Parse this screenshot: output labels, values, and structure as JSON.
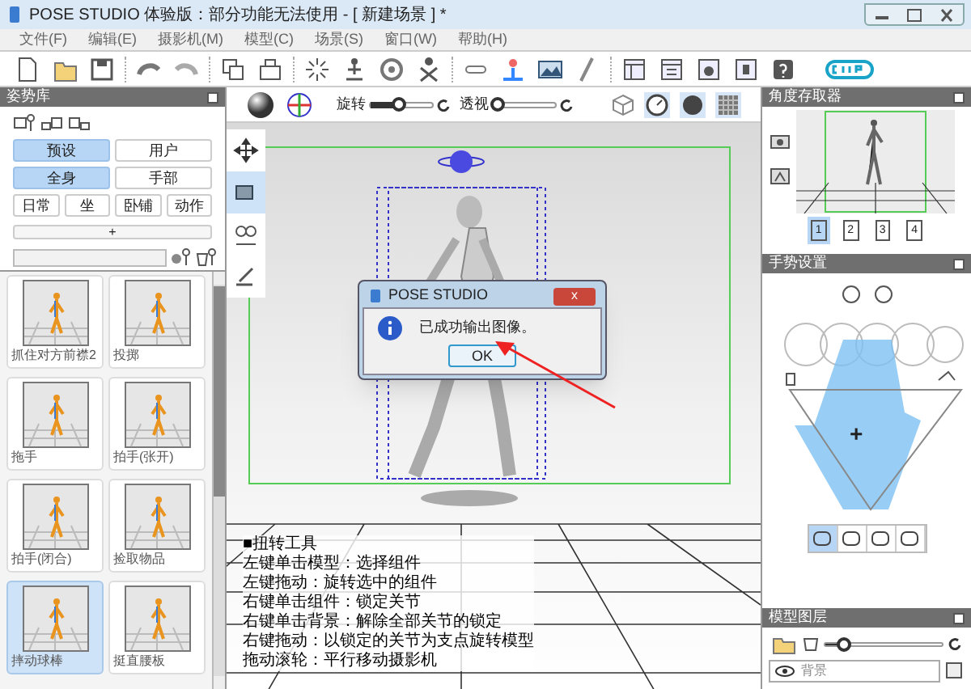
{
  "window": {
    "title": "POSE STUDIO 体验版：部分功能无法使用 - [ 新建场景 ] *"
  },
  "menu": [
    {
      "label": "文件(F)"
    },
    {
      "label": "编辑(E)"
    },
    {
      "label": "摄影机(M)"
    },
    {
      "label": "模型(C)"
    },
    {
      "label": "场景(S)"
    },
    {
      "label": "窗口(W)"
    },
    {
      "label": "帮助(H)"
    }
  ],
  "pose_library": {
    "title": "姿势库",
    "source_tabs": [
      {
        "label": "预设",
        "selected": true
      },
      {
        "label": "用户",
        "selected": false
      }
    ],
    "body_tabs": [
      {
        "label": "全身",
        "selected": true
      },
      {
        "label": "手部",
        "selected": false
      }
    ],
    "categories": [
      {
        "label": "日常"
      },
      {
        "label": "坐"
      },
      {
        "label": "卧铺"
      },
      {
        "label": "动作"
      }
    ],
    "add": "+",
    "poses": [
      {
        "label": "抓住对方前襟2",
        "selected": false
      },
      {
        "label": "投掷",
        "selected": false
      },
      {
        "label": "拖手",
        "selected": false
      },
      {
        "label": "拍手(张开)",
        "selected": false
      },
      {
        "label": "拍手(闭合)",
        "selected": false
      },
      {
        "label": "捡取物品",
        "selected": false
      },
      {
        "label": "摔动球棒",
        "selected": true
      },
      {
        "label": "挺直腰板",
        "selected": false
      }
    ]
  },
  "viewport": {
    "rotate": {
      "label": "旋转",
      "level": 0.45
    },
    "perspective": {
      "label": "透视",
      "level": 0.05
    },
    "help_lines": [
      "■扭转工具",
      "左键单击模型：选择组件",
      "左键拖动：旋转选中的组件",
      "右键单击组件：锁定关节",
      "右键单击背景：解除全部关节的锁定",
      "右键拖动：以锁定的关节为支点旋转模型",
      "拖动滚轮：平行移动摄影机"
    ]
  },
  "dialog": {
    "title": "POSE STUDIO",
    "close": "x",
    "message": "已成功输出图像。",
    "ok": "OK"
  },
  "angle_store": {
    "title": "角度存取器",
    "slots": [
      {
        "label": "1",
        "selected": true
      },
      {
        "label": "2",
        "selected": false
      },
      {
        "label": "3",
        "selected": false
      },
      {
        "label": "4",
        "selected": false
      }
    ]
  },
  "gesture": {
    "title": "手势设置",
    "center": "+",
    "buttons": [
      {
        "selected": true
      },
      {
        "selected": false
      },
      {
        "selected": false
      },
      {
        "selected": false
      }
    ]
  },
  "model_layers": {
    "title": "模型图层",
    "opacity": {
      "level": 0.15
    },
    "layer": "背景"
  }
}
